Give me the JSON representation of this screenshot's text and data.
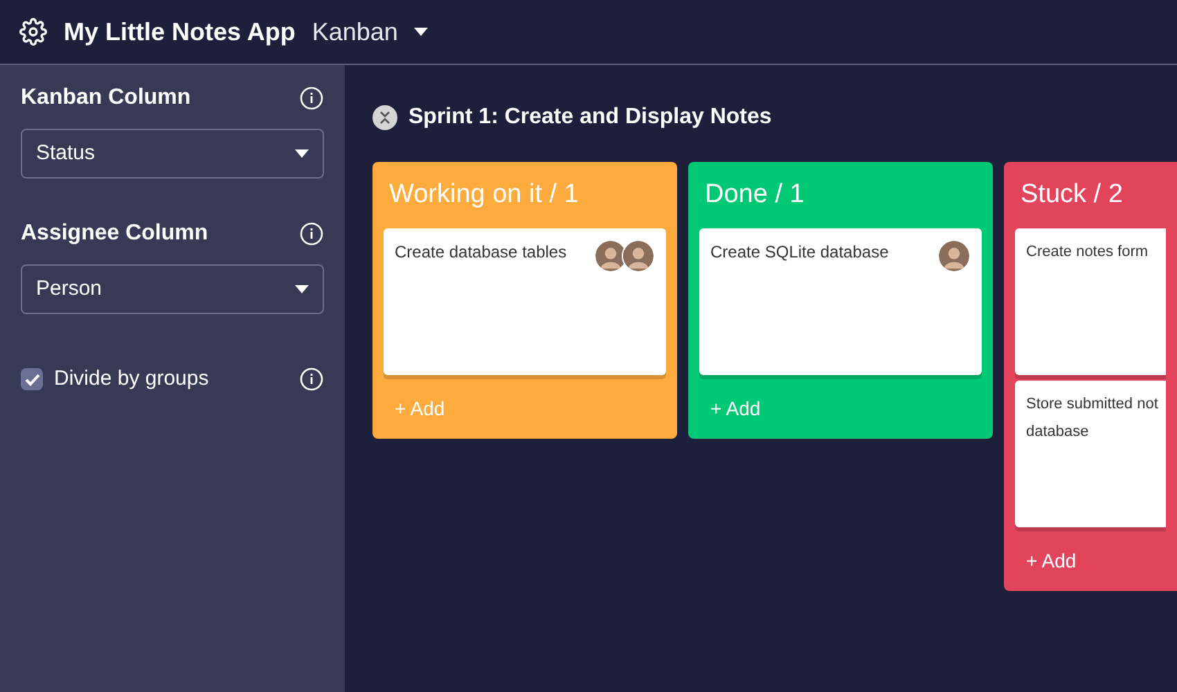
{
  "header": {
    "app_title": "My Little Notes App",
    "view": "Kanban"
  },
  "sidebar": {
    "fields": [
      {
        "kind": "select",
        "label": "Kanban Column",
        "value": "Status"
      },
      {
        "kind": "select",
        "label": "Assignee Column",
        "value": "Person"
      },
      {
        "kind": "checkbox",
        "label": "Divide by groups",
        "checked": true
      }
    ]
  },
  "group": {
    "title": "Sprint 1: Create and Display Notes"
  },
  "columns": [
    {
      "title": "Working on it / 1",
      "color": "#fdab3d",
      "add": "+ Add",
      "cards": [
        {
          "text": "Create database tables",
          "assignees": [
            {
              "kind": "photo"
            },
            {
              "kind": "photo"
            }
          ]
        }
      ]
    },
    {
      "title": "Done / 1",
      "color": "#00c875",
      "add": "+ Add",
      "cards": [
        {
          "text": "Create SQLite database",
          "assignees": [
            {
              "kind": "photo"
            }
          ]
        }
      ]
    },
    {
      "title": "Stuck / 2",
      "color": "#e2445c",
      "add": "+ Add",
      "cards": [
        {
          "text": "Create notes form"
        },
        {
          "text": "Store submitted not\ndatabase"
        }
      ]
    }
  ]
}
